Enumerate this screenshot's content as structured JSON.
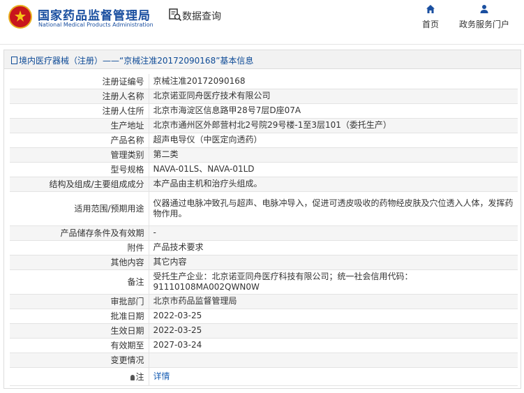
{
  "header": {
    "site_name_cn": "国家药品监督管理局",
    "site_name_en": "National Medical Products Administration",
    "query_label": "数据查询",
    "nav": [
      {
        "label": "首页",
        "icon": "home-icon"
      },
      {
        "label": "政务服务门户",
        "icon": "user-icon"
      }
    ],
    "accent_color": "#1a4fa0",
    "emblem_color": "#c8161d"
  },
  "panel": {
    "title": "境内医疗器械（注册）——“京械注准20172090168”基本信息"
  },
  "rows": [
    {
      "label": "注册证编号",
      "value": "京械注准20172090168"
    },
    {
      "label": "注册人名称",
      "value": "北京诺亚同舟医疗技术有限公司"
    },
    {
      "label": "注册人住所",
      "value": "北京市海淀区信息路甲28号7层D座07A"
    },
    {
      "label": "生产地址",
      "value": "北京市通州区外郎营村北2号院29号楼-1至3层101（委托生产）"
    },
    {
      "label": "产品名称",
      "value": "超声电导仪（中医定向透药）"
    },
    {
      "label": "管理类别",
      "value": "第二类"
    },
    {
      "label": "型号规格",
      "value": "NAVA-01LS、NAVA-01LD"
    },
    {
      "label": "结构及组成/主要组成成分",
      "value": "本产品由主机和治疗头组成。"
    },
    {
      "label": "适用范围/预期用途",
      "value": "仪器通过电脉冲致孔与超声、电脉冲导入，促进可透皮吸收的药物经皮肤及穴位透入人体，发挥药物作用。"
    },
    {
      "label": "产品储存条件及有效期",
      "value": "-"
    },
    {
      "label": "附件",
      "value": "产品技术要求"
    },
    {
      "label": "其他内容",
      "value": "其它内容"
    },
    {
      "label": "备注",
      "value": "受托生产企业：北京诺亚同舟医疗科技有限公司；统一社会信用代码：91110108MA002QWN0W"
    },
    {
      "label": "审批部门",
      "value": "北京市药品监督管理局"
    },
    {
      "label": "批准日期",
      "value": "2022-03-25"
    },
    {
      "label": "生效日期",
      "value": "2022-03-25"
    },
    {
      "label": "有效期至",
      "value": "2027-03-24"
    },
    {
      "label": "变更情况",
      "value": ""
    },
    {
      "label": "注",
      "value": "详情"
    }
  ]
}
